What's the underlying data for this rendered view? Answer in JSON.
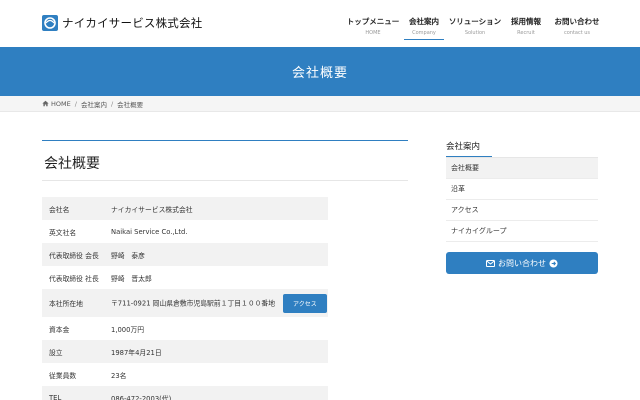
{
  "header": {
    "logo_text": "ナイカイサービス株式会社",
    "nav": [
      {
        "jp": "トップメニュー",
        "en": "HOME"
      },
      {
        "jp": "会社案内",
        "en": "Company"
      },
      {
        "jp": "ソリューション",
        "en": "Solution"
      },
      {
        "jp": "採用情報",
        "en": "Recruit"
      },
      {
        "jp": "お問い合わせ",
        "en": "contact us"
      }
    ]
  },
  "banner": {
    "title": "会社概要"
  },
  "breadcrumb": {
    "home": "HOME",
    "company": "会社案内",
    "current": "会社概要",
    "separator": "/"
  },
  "main": {
    "title": "会社概要",
    "rows": [
      {
        "label": "会社名",
        "value": "ナイカイサービス株式会社"
      },
      {
        "label": "英文社名",
        "value": "Naikai Service Co.,Ltd."
      },
      {
        "label": "代表取締役 会長",
        "value": "野崎　泰彦"
      },
      {
        "label": "代表取締役 社長",
        "value": "野崎　晋太郎"
      },
      {
        "label": "本社所在地",
        "value": "〒711-0921 岡山県倉敷市児島駅前１丁目１００番地",
        "button": "アクセス"
      },
      {
        "label": "資本金",
        "value": "1,000万円"
      },
      {
        "label": "設立",
        "value": "1987年4月21日"
      },
      {
        "label": "従業員数",
        "value": "23名"
      },
      {
        "label": "TEL",
        "value": "086-472-2003(代)"
      }
    ]
  },
  "sidebar": {
    "title": "会社案内",
    "items": [
      "会社概要",
      "沿革",
      "アクセス",
      "ナイカイグループ"
    ],
    "contact_label": "お問い合わせ"
  },
  "colors": {
    "accent": "#2f7fc1",
    "row_shade": "#f2f2f2"
  }
}
